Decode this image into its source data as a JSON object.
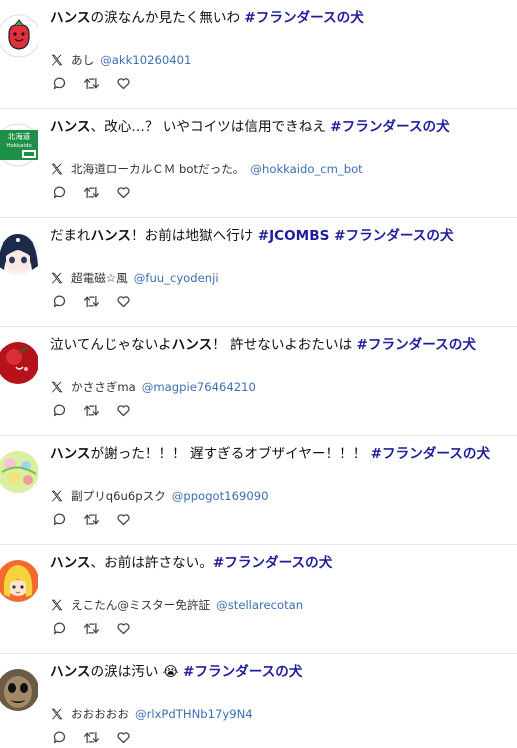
{
  "tweets": [
    {
      "lead": "ハンス",
      "rest": "の涙なんか見たく無いわ ",
      "hashtag": "#フランダースの犬",
      "name": "あし",
      "handle": "@akk10260401",
      "avatar_icon": "tomato-avatar-icon"
    },
    {
      "lead": "ハンス",
      "rest": "、改心…？ いやコイツは信用できねえ ",
      "hashtag": "#フランダースの犬",
      "name": "北海道ローカルＣＭ botだった。",
      "handle": "@hokkaido_cm_bot",
      "avatar_icon": "hokkaido-logo-avatar-icon",
      "avatar_text": [
        "北海道",
        "Hokkaido"
      ]
    },
    {
      "lead": "だまれ",
      "lead2": "ハンス",
      "rest": "！お前は地獄へ行け ",
      "hashtag": "#JCOMBS #フランダースの犬",
      "name": "超電磁☆風",
      "handle": "@fuu_cyodenji",
      "avatar_icon": "anime-girl-avatar-icon"
    },
    {
      "lead": "泣いてんじゃないよ",
      "lead2": "ハンス",
      "rest": "！ 許せないよおたいは ",
      "hashtag": "#フランダースの犬",
      "name": "かささぎma",
      "handle": "@magpie76464210",
      "avatar_icon": "red-apple-avatar-icon"
    },
    {
      "lead": "ハンス",
      "rest": "が謝った！！！ 遅すぎるオブザイヤー！！！ ",
      "hashtag": "#フランダースの犬",
      "name": "副プリq6u6pスク",
      "handle": "@ppogot169090",
      "avatar_icon": "colorful-pattern-avatar-icon"
    },
    {
      "lead": "ハンス",
      "rest": "、お前は許さない。",
      "hashtag": "#フランダースの犬",
      "name": "えこたん@ミスター免許証",
      "handle": "@stellarecotan",
      "avatar_icon": "blonde-character-avatar-icon"
    },
    {
      "lead": "ハンス",
      "rest": "の涙は汚い 😭 ",
      "hashtag": "#フランダースの犬",
      "name": "おおおおお",
      "handle": "@rlxPdTHNb17y9N4",
      "avatar_icon": "dark-face-avatar-icon"
    }
  ],
  "icons": {
    "source": "x-logo-icon",
    "reply": "reply-icon",
    "retweet": "retweet-icon",
    "like": "heart-icon"
  },
  "colors": {
    "hashtag": "#1c1c9c",
    "handle": "#3c6fb3",
    "text": "#111111"
  }
}
